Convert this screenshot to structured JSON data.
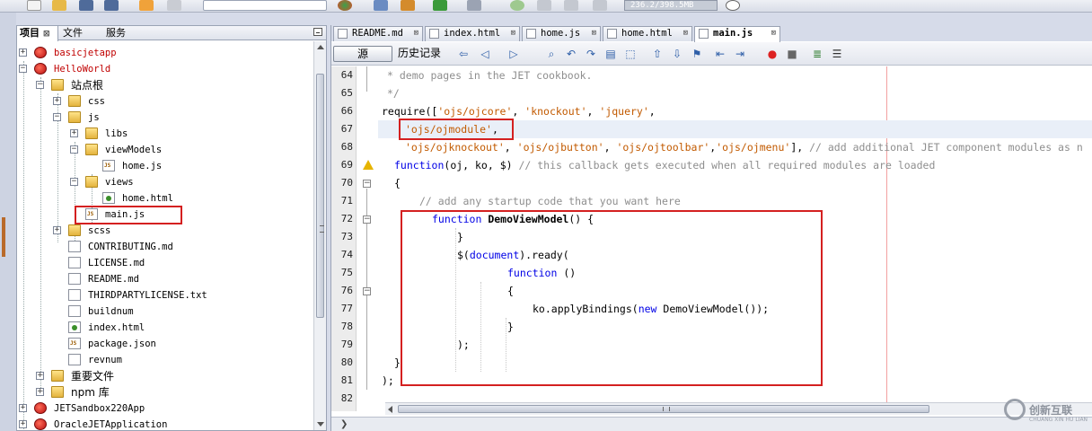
{
  "toolbar": {
    "memory": "236.2/398.5MB"
  },
  "left_panel": {
    "tabs": [
      {
        "label": "项目",
        "close": "⊠"
      },
      {
        "label": "文件",
        "close": ""
      },
      {
        "label": "服务",
        "close": ""
      }
    ],
    "tree": [
      {
        "label": "basicjetapp",
        "icon": "project-icon",
        "expand": "+"
      },
      {
        "label": "HelloWorld",
        "icon": "project-icon",
        "expand": "−"
      },
      {
        "label": "站点根",
        "icon": "folder-icon",
        "expand": "−"
      },
      {
        "label": "css",
        "icon": "folder-icon",
        "expand": "+"
      },
      {
        "label": "js",
        "icon": "folder-icon",
        "expand": "−"
      },
      {
        "label": "libs",
        "icon": "folder-icon",
        "expand": "+"
      },
      {
        "label": "viewModels",
        "icon": "folder-icon",
        "expand": "−"
      },
      {
        "label": "home.js",
        "icon": "js-file-icon",
        "expand": ""
      },
      {
        "label": "views",
        "icon": "folder-icon",
        "expand": "−"
      },
      {
        "label": "home.html",
        "icon": "html-file-icon",
        "expand": ""
      },
      {
        "label": "main.js",
        "icon": "js-file-icon",
        "expand": ""
      },
      {
        "label": "scss",
        "icon": "folder-icon",
        "expand": "+"
      },
      {
        "label": "CONTRIBUTING.md",
        "icon": "file-icon",
        "expand": ""
      },
      {
        "label": "LICENSE.md",
        "icon": "file-icon",
        "expand": ""
      },
      {
        "label": "README.md",
        "icon": "file-icon",
        "expand": ""
      },
      {
        "label": "THIRDPARTYLICENSE.txt",
        "icon": "file-icon",
        "expand": ""
      },
      {
        "label": "buildnum",
        "icon": "file-icon",
        "expand": ""
      },
      {
        "label": "index.html",
        "icon": "html-file-icon",
        "expand": ""
      },
      {
        "label": "package.json",
        "icon": "js-file-icon",
        "expand": ""
      },
      {
        "label": "revnum",
        "icon": "file-icon",
        "expand": ""
      },
      {
        "label": "重要文件",
        "icon": "folder-icon",
        "expand": "+"
      },
      {
        "label": "npm 库",
        "icon": "folder-icon",
        "expand": "+"
      },
      {
        "label": "JETSandbox220App",
        "icon": "project-icon",
        "expand": "+"
      },
      {
        "label": "OracleJETApplication",
        "icon": "project-icon",
        "expand": "+"
      }
    ]
  },
  "editor": {
    "tabs": [
      {
        "label": "README.md",
        "close": "⊠"
      },
      {
        "label": "index.html",
        "close": "⊠"
      },
      {
        "label": "home.js",
        "close": "⊠"
      },
      {
        "label": "home.html",
        "close": "⊠"
      },
      {
        "label": "main.js",
        "close": "⊠"
      }
    ],
    "source_button": "源",
    "history_button": "历史记录",
    "lines": [
      64,
      65,
      66,
      67,
      68,
      69,
      70,
      71,
      72,
      73,
      74,
      75,
      76,
      77,
      78,
      79,
      80,
      81,
      82
    ],
    "code": {
      "l64": "* demo pages in the JET cookbook.",
      "l65": "*/",
      "l66_a": "require([",
      "l66_s1": "'ojs/ojcore'",
      "l66_b": ", ",
      "l66_s2": "'knockout'",
      "l66_c": ", ",
      "l66_s3": "'jquery'",
      "l66_d": ",",
      "l67_s": "'ojs/ojmodule'",
      "l67_d": ",",
      "l68_s1": "'ojs/ojknockout'",
      "l68_a": ", ",
      "l68_s2": "'ojs/ojbutton'",
      "l68_b": ", ",
      "l68_s3": "'ojs/ojtoolbar'",
      "l68_c": ",",
      "l68_s4": "'ojs/ojmenu'",
      "l68_d": "], ",
      "l68_cm": "// add additional JET component modules as n",
      "l69_kw": "function",
      "l69_a": "(oj, ko, $) ",
      "l69_cm": "// this callback gets executed when all required modules are loaded",
      "l70": "{",
      "l71_cm": "// add any startup code that you want here",
      "l72_kw": "function",
      "l72_fn": "DemoViewModel",
      "l72_a": "() {",
      "l73": "}",
      "l74_a": "$(",
      "l74_kw": "document",
      "l74_b": ").ready(",
      "l75_kw": "function",
      "l75_a": " ()",
      "l76": "{",
      "l77_a": "ko.applyBindings(",
      "l77_kw": "new",
      "l77_b": " DemoViewModel());",
      "l78": "}",
      "l79": ");",
      "l80": "}",
      "l81": ");"
    }
  },
  "watermark": {
    "title": "创新互联",
    "subtitle": "CHUANG XIN HU LIAN"
  }
}
